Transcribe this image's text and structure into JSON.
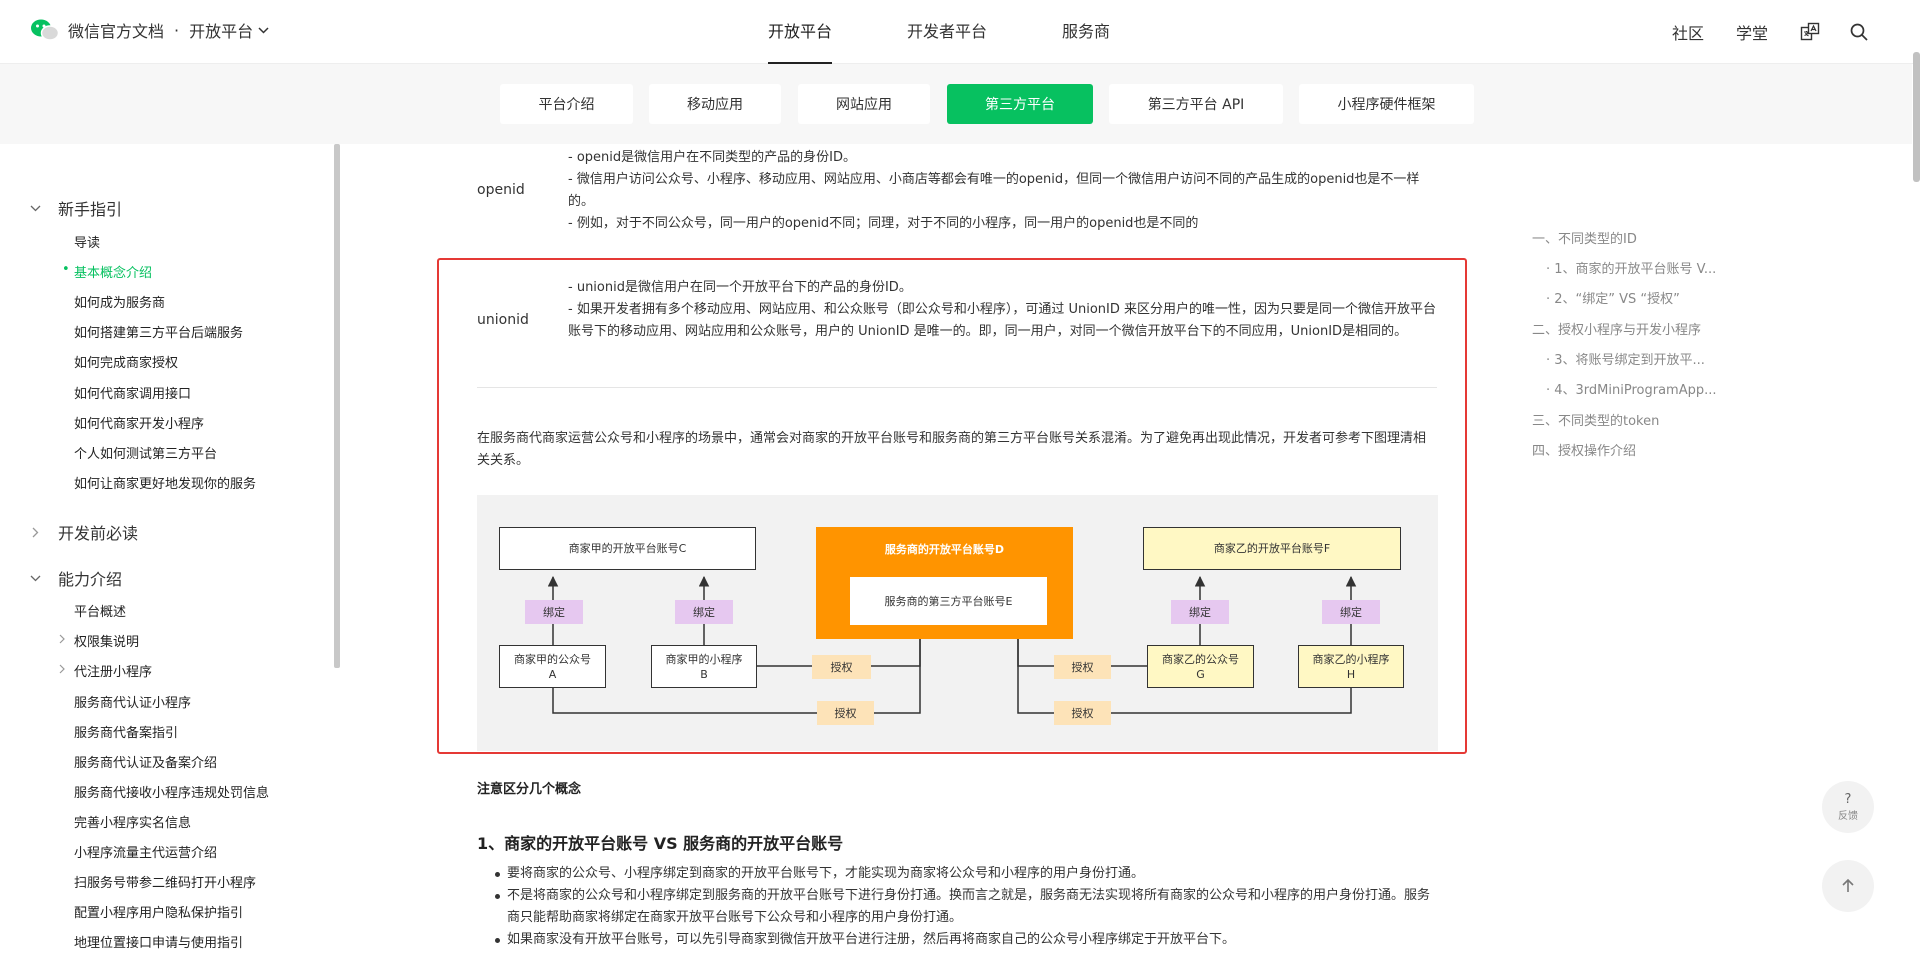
{
  "header": {
    "logo_text": "微信官方文档",
    "dot": "·",
    "platform_label": "开放平台",
    "nav": [
      "开放平台",
      "开发者平台",
      "服务商"
    ],
    "community": "社区",
    "academy": "学堂"
  },
  "subnav": {
    "tabs": [
      "平台介绍",
      "移动应用",
      "网站应用",
      "第三方平台",
      "第三方平台 API",
      "小程序硬件框架"
    ],
    "active_index": 3,
    "active_color": "#07c160"
  },
  "sidebar": {
    "sections": [
      {
        "label": "新手指引",
        "expanded": true
      },
      {
        "label": "开发前必读",
        "expanded": false
      },
      {
        "label": "能力介绍",
        "expanded": true
      }
    ],
    "guide_items": [
      "导读",
      "基本概念介绍",
      "如何成为服务商",
      "如何搭建第三方平台后端服务",
      "如何完成商家授权",
      "如何代商家调用接口",
      "如何代商家开发小程序",
      "个人如何测试第三方平台",
      "如何让商家更好地发现你的服务"
    ],
    "guide_active_index": 1,
    "ability_items": [
      "平台概述",
      "权限集说明",
      "代注册小程序",
      "服务商代认证小程序",
      "服务商代备案指引",
      "服务商代认证及备案介绍",
      "服务商代接收小程序违规处罚信息",
      "完善小程序实名信息",
      "小程序流量主代运营介绍",
      "扫服务号带参二维码打开小程序",
      "配置小程序用户隐私保护指引",
      "地理位置接口申请与使用指引"
    ]
  },
  "content": {
    "openid_term": "openid",
    "openid_lines": [
      "- openid是微信用户在不同类型的产品的身份ID。",
      "- 微信用户访问公众号、小程序、移动应用、网站应用、小商店等都会有唯一的openid，但同一个微信用户访问不同的产品生成的openid也是不一样的。",
      "- 例如，对于不同公众号，同一用户的openid不同；同理，对于不同的小程序，同一用户的openid也是不同的"
    ],
    "unionid_term": "unionid",
    "unionid_lines": [
      "- unionid是微信用户在同一个开放平台下的产品的身份ID。",
      "- 如果开发者拥有多个移动应用、网站应用、和公众账号（即公众号和小程序），可通过 UnionID 来区分用户的唯一性，因为只要是同一个微信开放平台账号下的移动应用、网站应用和公众账号，用户的 UnionID 是唯一的。即，同一用户，对同一个微信开放平台下的不同应用，UnionID是相同的。"
    ],
    "intro_paragraph": "在服务商代商家运营公众号和小程序的场景中，通常会对商家的开放平台账号和服务商的第三方平台账号关系混淆。为了避免再出现此情况，开发者可参考下图理清相关关系。",
    "diagram": {
      "box_c": "商家甲的开放平台账号C",
      "box_d": "服务商的开放平台账号D",
      "box_e": "服务商的第三方平台账号E",
      "box_f": "商家乙的开放平台账号F",
      "box_a": "商家甲的公众号\nA",
      "box_b": "商家甲的小程序\nB",
      "box_g": "商家乙的公众号\nG",
      "box_h": "商家乙的小程序\nH",
      "bind_label": "绑定",
      "auth_label": "授权",
      "colors": {
        "orange": "#ff9400",
        "yellow": "#fff8c4",
        "purple": "#e6c8f0",
        "auth": "#fde3b8",
        "bg": "#f2f2f2"
      }
    },
    "note_heading": "注意区分几个概念",
    "h3": "1、商家的开放平台账号 VS 服务商的开放平台账号",
    "bullets": [
      "要将商家的公众号、小程序绑定到商家的开放平台账号下，才能实现为商家将公众号和小程序的用户身份打通。",
      "不是将商家的公众号和小程序绑定到服务商的开放平台账号下进行身份打通。换而言之就是，服务商无法实现将所有商家的公众号和小程序的用户身份打通。服务商只能帮助商家将绑定在商家开放平台账号下公众号和小程序的用户身份打通。",
      "如果商家没有开放平台账号，可以先引导商家到微信开放平台进行注册，然后再将商家自己的公众号小程序绑定于开放平台下。"
    ]
  },
  "toc": [
    "一、不同类型的ID",
    "· 1、商家的开放平台账号 V...",
    "· 2、“绑定” VS “授权”",
    "二、授权小程序与开发小程序",
    "· 3、将账号绑定到开放平...",
    "· 4、3rdMiniProgramApp...",
    "三、不同类型的token",
    "四、授权操作介绍"
  ],
  "float": {
    "question": "?",
    "feedback": "反馈"
  }
}
